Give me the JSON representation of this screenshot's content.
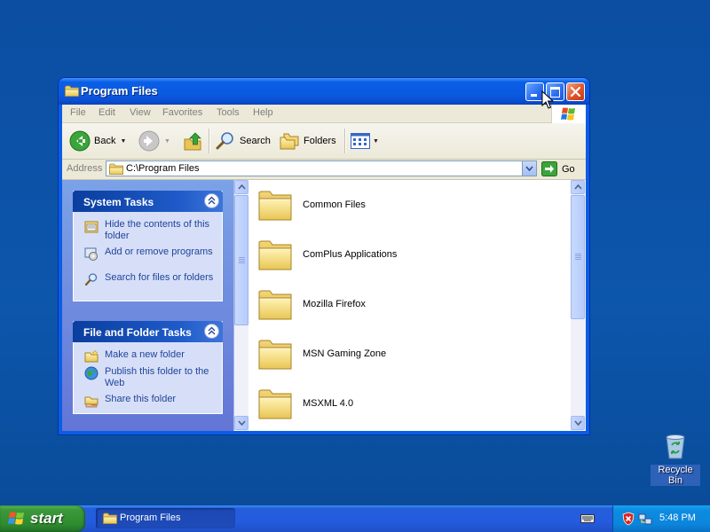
{
  "window": {
    "title": "Program Files",
    "menu": [
      "File",
      "Edit",
      "View",
      "Favorites",
      "Tools",
      "Help"
    ],
    "toolbar": {
      "back_label": "Back",
      "search_label": "Search",
      "folders_label": "Folders"
    },
    "address": {
      "label": "Address",
      "value": "C:\\Program Files",
      "go_label": "Go"
    },
    "task_panels": [
      {
        "title": "System Tasks",
        "items": [
          {
            "label": "Hide the contents of this folder",
            "icon": "folder-contents-icon"
          },
          {
            "label": "Add or remove programs",
            "icon": "add-remove-programs-icon"
          },
          {
            "label": "Search for files or folders",
            "icon": "search-icon"
          }
        ]
      },
      {
        "title": "File and Folder Tasks",
        "items": [
          {
            "label": "Make a new folder",
            "icon": "new-folder-icon"
          },
          {
            "label": "Publish this folder to the Web",
            "icon": "publish-web-icon"
          },
          {
            "label": "Share this folder",
            "icon": "share-folder-icon"
          }
        ]
      }
    ],
    "files": [
      "Common Files",
      "ComPlus Applications",
      "Mozilla Firefox",
      "MSN Gaming Zone",
      "MSXML 4.0"
    ]
  },
  "desktop": {
    "recycle_bin_label": "Recycle Bin"
  },
  "taskbar": {
    "start_label": "start",
    "task_button_label": "Program Files",
    "clock": "5:48 PM"
  },
  "colors": {
    "desktop": "#0a4f9f",
    "titlebar": "#0a5fe6",
    "taskpane_link": "#21449c",
    "start_button": "#3c9a3c",
    "tray": "#0d8be1"
  }
}
